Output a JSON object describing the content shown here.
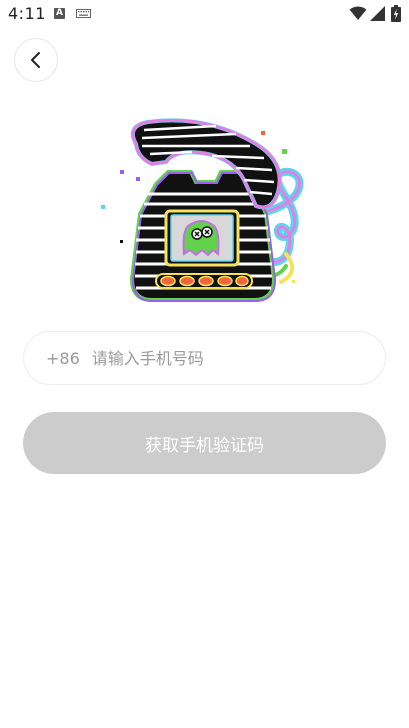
{
  "status_bar": {
    "time": "4:11",
    "notification_a": "A",
    "icons": [
      "keyboard-icon",
      "wifi-icon",
      "signal-icon",
      "battery-icon"
    ]
  },
  "header": {
    "back_icon": "chevron-left-icon"
  },
  "illustration": {
    "name": "retro-telephone-illustration",
    "colors": {
      "handset": "#e27fe3",
      "body": "#9a5ef0",
      "screen": "#d8d8d8",
      "monster": "#62d14b",
      "buttons": "#f2663c",
      "accent_cyan": "#59d7f0",
      "accent_yellow": "#f6e25a"
    }
  },
  "form": {
    "country_code": "+86",
    "phone_placeholder": "请输入手机号码",
    "phone_value": "",
    "submit_label": "获取手机验证码"
  },
  "colors": {
    "button_disabled_bg": "#cccccc",
    "button_text": "#ffffff",
    "placeholder": "#9a9a9a",
    "input_border": "#ececec"
  }
}
